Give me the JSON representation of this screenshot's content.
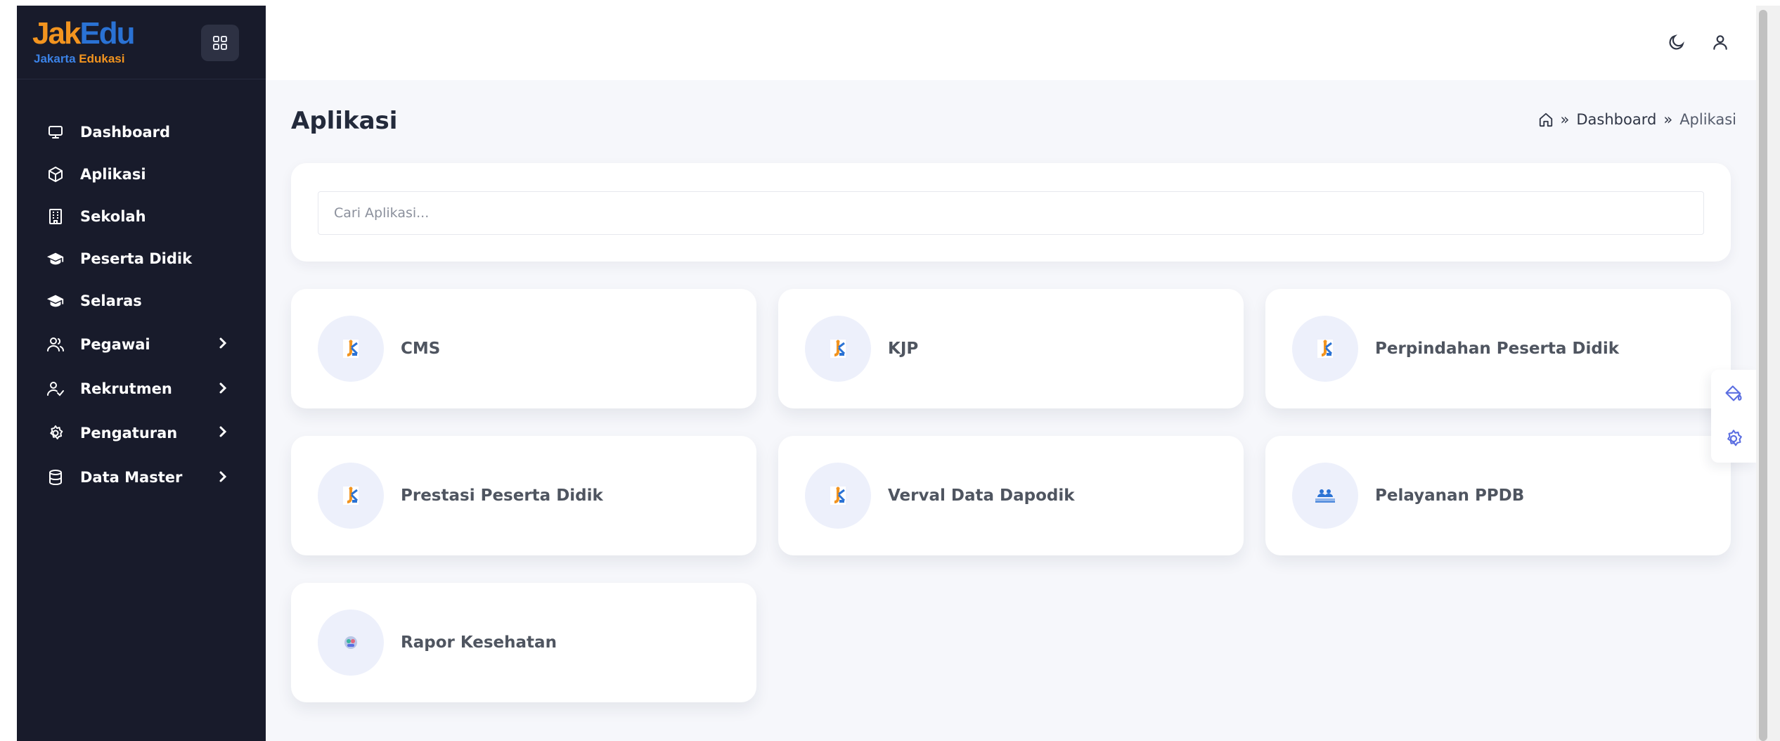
{
  "brand": {
    "logo_j": "J",
    "logo_ak": "ak",
    "logo_e": "E",
    "logo_du": "du",
    "sub_a": "Jakarta ",
    "sub_b": "Edukasi"
  },
  "sidebar": {
    "items": [
      {
        "label": "Dashboard",
        "icon": "monitor-icon",
        "has_children": false
      },
      {
        "label": "Aplikasi",
        "icon": "cube-icon",
        "has_children": false
      },
      {
        "label": "Sekolah",
        "icon": "building-icon",
        "has_children": false
      },
      {
        "label": "Peserta Didik",
        "icon": "graduation-cap-icon",
        "has_children": false
      },
      {
        "label": "Selaras",
        "icon": "graduation-cap-icon",
        "has_children": false
      },
      {
        "label": "Pegawai",
        "icon": "users-icon",
        "has_children": true
      },
      {
        "label": "Rekrutmen",
        "icon": "user-check-icon",
        "has_children": true
      },
      {
        "label": "Pengaturan",
        "icon": "gear-icon",
        "has_children": true
      },
      {
        "label": "Data Master",
        "icon": "database-icon",
        "has_children": true
      }
    ]
  },
  "header": {
    "page_title": "Aplikasi",
    "breadcrumb": [
      "Dashboard",
      "Aplikasi"
    ],
    "breadcrumb_sep": "»"
  },
  "search": {
    "placeholder": "Cari Aplikasi..."
  },
  "apps": [
    {
      "name": "CMS",
      "icon": "jakedu-logo-icon"
    },
    {
      "name": "KJP",
      "icon": "jakedu-logo-icon"
    },
    {
      "name": "Perpindahan Peserta Didik",
      "icon": "jakedu-logo-icon"
    },
    {
      "name": "Prestasi Peserta Didik",
      "icon": "jakedu-logo-icon"
    },
    {
      "name": "Verval Data Dapodik",
      "icon": "jakedu-logo-icon"
    },
    {
      "name": "Pelayanan PPDB",
      "icon": "ppdb-logo-icon"
    },
    {
      "name": "Rapor Kesehatan",
      "icon": "health-logo-icon"
    }
  ],
  "colors": {
    "sidebar_bg": "#181b2b",
    "main_bg": "#f6f7fb",
    "accent": "#5b6ee1",
    "brand_orange": "#f2941f",
    "brand_blue": "#2a72d4"
  }
}
